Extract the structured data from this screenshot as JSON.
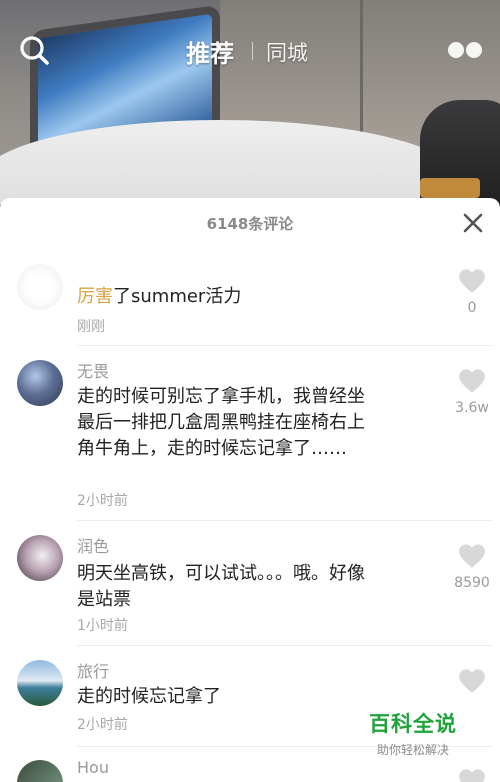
{
  "header": {
    "tabs": [
      {
        "label": "推荐",
        "active": true
      },
      {
        "label": "同城",
        "active": false
      }
    ]
  },
  "sheet": {
    "comment_count": "6148条评论"
  },
  "comments": [
    {
      "username": "",
      "text_highlight": "厉害",
      "text": "了summer活力",
      "time": "刚刚",
      "likes": "0"
    },
    {
      "username": "无畏",
      "text": "走的时候可别忘了拿手机，我曾经坐最后一排把几盒周黑鸭挂在座椅右上角牛角上，走的时候忘记拿了……",
      "time": "2小时前",
      "likes": "3.6w"
    },
    {
      "username": "润色",
      "text": "明天坐高铁，可以试试。。。哦。好像是站票",
      "time": "1小时前",
      "likes": "8590"
    },
    {
      "username": "旅行",
      "text": "走的时候忘记拿了",
      "time": "2小时前",
      "likes": ""
    },
    {
      "username": "Hou",
      "text": "",
      "time": "",
      "likes": ""
    }
  ],
  "watermark": {
    "title": "百科全说",
    "subtitle": "助你轻松解决"
  },
  "colors": {
    "highlight": "#d9a441",
    "watermark_green": "#1fa33a",
    "like_gray": "#d8d8d8"
  },
  "icons": [
    "search-icon",
    "more-dots-icon",
    "close-icon",
    "heart-icon"
  ]
}
